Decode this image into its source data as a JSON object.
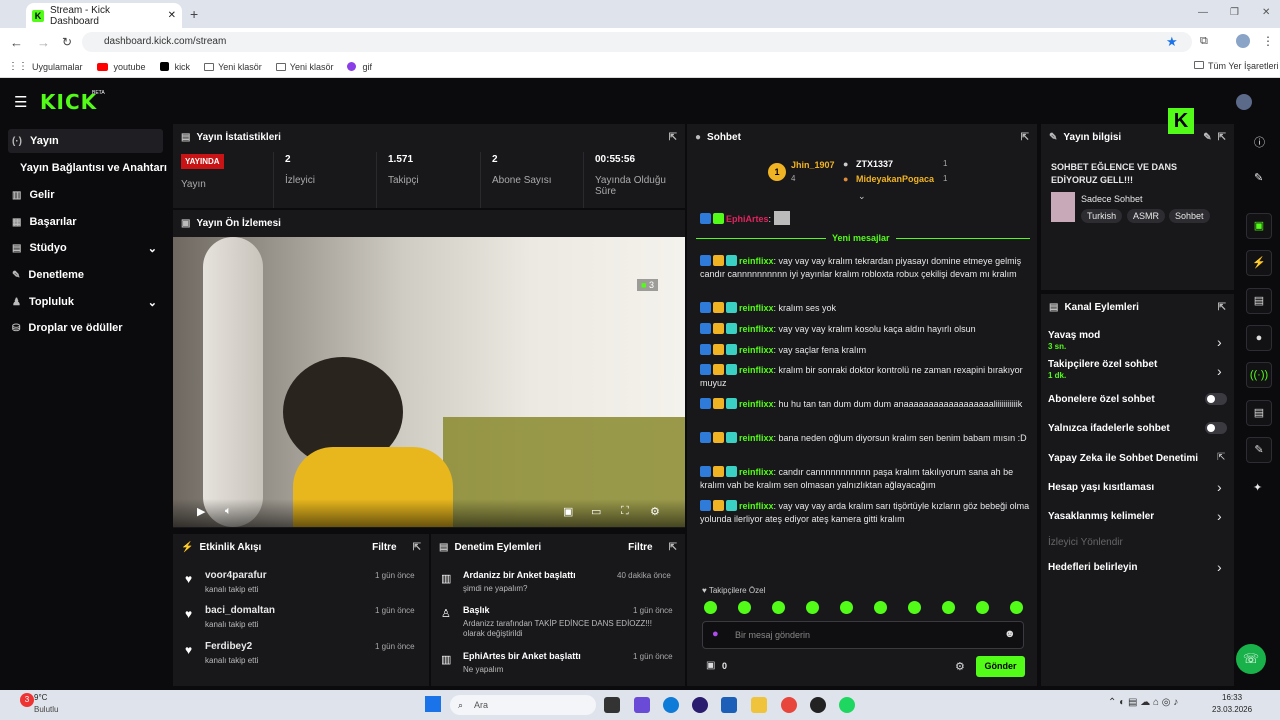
{
  "browser": {
    "tab_title": "Stream - Kick Dashboard",
    "url": "dashboard.kick.com/stream",
    "bookmarks": [
      "Uygulamalar",
      "youtube",
      "kick",
      "Yeni klasör",
      "Yeni klasör",
      "gif"
    ],
    "all_bookmarks": "Tüm Yer İşaretleri"
  },
  "brand": {
    "logo": "KICK",
    "beta": "BETA"
  },
  "sidebar": {
    "items": [
      {
        "label": "Yayın"
      },
      {
        "label": "Yayın Bağlantısı ve Anahtarı"
      },
      {
        "label": "Gelir"
      },
      {
        "label": "Başarılar"
      },
      {
        "label": "Stüdyo"
      },
      {
        "label": "Denetleme"
      },
      {
        "label": "Topluluk"
      },
      {
        "label": "Droplar ve ödüller"
      }
    ]
  },
  "stats": {
    "title": "Yayın İstatistikleri",
    "live_badge": "YAYINDA",
    "live_label": "Yayın",
    "items": [
      {
        "value": "2",
        "label": "İzleyici"
      },
      {
        "value": "1.571",
        "label": "Takipçi"
      },
      {
        "value": "2",
        "label": "Abone Sayısı"
      },
      {
        "value": "00:55:56",
        "label": "Yayında Olduğu Süre"
      }
    ]
  },
  "preview": {
    "title": "Yayın Ön İzlemesi",
    "viewer_count": "3"
  },
  "events": {
    "title": "Etkinlik Akışı",
    "filter": "Filtre",
    "items": [
      {
        "user": "voor4parafur",
        "action": "kanalı takip etti",
        "time": "1 gün önce"
      },
      {
        "user": "baci_domaltan",
        "action": "kanalı takip etti",
        "time": "1 gün önce"
      },
      {
        "user": "Ferdibey2",
        "action": "kanalı takip etti",
        "time": "1 gün önce"
      }
    ]
  },
  "mod": {
    "title": "Denetim Eylemleri",
    "filter": "Filtre",
    "items": [
      {
        "title": "Ardanizz bir Anket başlattı",
        "sub": "şimdi ne yapalım?",
        "time": "40 dakika önce"
      },
      {
        "title": "Başlık",
        "sub": "Ardanizz tarafından TAKİP EDİNCE DANS EDİOZZ!!! olarak değiştirildi",
        "time": "1 gün önce"
      },
      {
        "title": "EphiArtes bir Anket başlattı",
        "sub": "Ne yapalım",
        "time": "1 gün önce"
      }
    ]
  },
  "chat": {
    "title": "Sohbet",
    "leaders": [
      {
        "rank": "1",
        "name": "Jhin_1907",
        "count": "4"
      },
      {
        "name": "ZTX1337",
        "count": "1"
      },
      {
        "name": "MideyakanPogaca",
        "count": "1"
      }
    ],
    "first_user": "EphiArtes",
    "new_messages": "Yeni mesajlar",
    "messages": [
      {
        "user": "reinflixx",
        "text": "vay vay vay kralım tekrardan piyasayı domine etmeye gelmiş candır cannnnnnnnnn iyi yayınlar kralım robloxta robux çekilişi devam mı kralım"
      },
      {
        "user": "reinflixx",
        "text": "kralım ses yok"
      },
      {
        "user": "reinflixx",
        "text": "vay vay vay kralım kosolu kaça aldın hayırlı olsun"
      },
      {
        "user": "reinflixx",
        "text": "vay saçlar fena kralım"
      },
      {
        "user": "reinflixx",
        "text": "kralım bir sonraki doktor kontrolü ne zaman rexapini bırakıyor muyuz"
      },
      {
        "user": "reinflixx",
        "text": "hu hu tan tan dum dum dum anaaaaaaaaaaaaaaaaaaliiiiiiiiiiik"
      },
      {
        "user": "reinflixx",
        "text": "bana neden oğlum diyorsun kralım sen benim babam mısın :D"
      },
      {
        "user": "reinflixx",
        "text": "candır cannnnnnnnnnn paşa kralım takılıyorum sana ah be kralım vah be kralım sen olmasan yalnızlıktan ağlayacağım"
      },
      {
        "user": "reinflixx",
        "text": "vay vay vay arda kralım sarı tişörtüyle kızların göz bebeği olma yolunda ilerliyor ateş ediyor ateş kamera gitti kralım"
      }
    ],
    "followers_only": "Takipçilere Özel",
    "placeholder": "Bir mesaj gönderin",
    "points": "0",
    "send": "Gönder"
  },
  "info": {
    "title": "Yayın bilgisi",
    "stream_title": "SOHBET EĞLENCE VE DANS EDİYORUZ GELL!!!",
    "category": "Sadece Sohbet",
    "tags": [
      "Turkish",
      "ASMR",
      "Sohbet"
    ]
  },
  "actions": {
    "title": "Kanal Eylemleri",
    "items": [
      {
        "label": "Yavaş mod",
        "sub": "3 sn."
      },
      {
        "label": "Takipçilere özel sohbet",
        "sub": "1 dk."
      },
      {
        "label": "Abonelere özel sohbet"
      },
      {
        "label": "Yalnızca ifadelerle sohbet"
      },
      {
        "label": "Yapay Zeka ile Sohbet Denetimi"
      },
      {
        "label": "Hesap yaşı kısıtlaması"
      },
      {
        "label": "Yasaklanmış kelimeler"
      },
      {
        "label": "İzleyici Yönlendir"
      },
      {
        "label": "Hedefleri belirleyin"
      }
    ]
  },
  "taskbar": {
    "temp": "9°C",
    "weather": "Bulutlu",
    "search": "Ara",
    "time": "16:33",
    "date": "23.03.2026"
  }
}
